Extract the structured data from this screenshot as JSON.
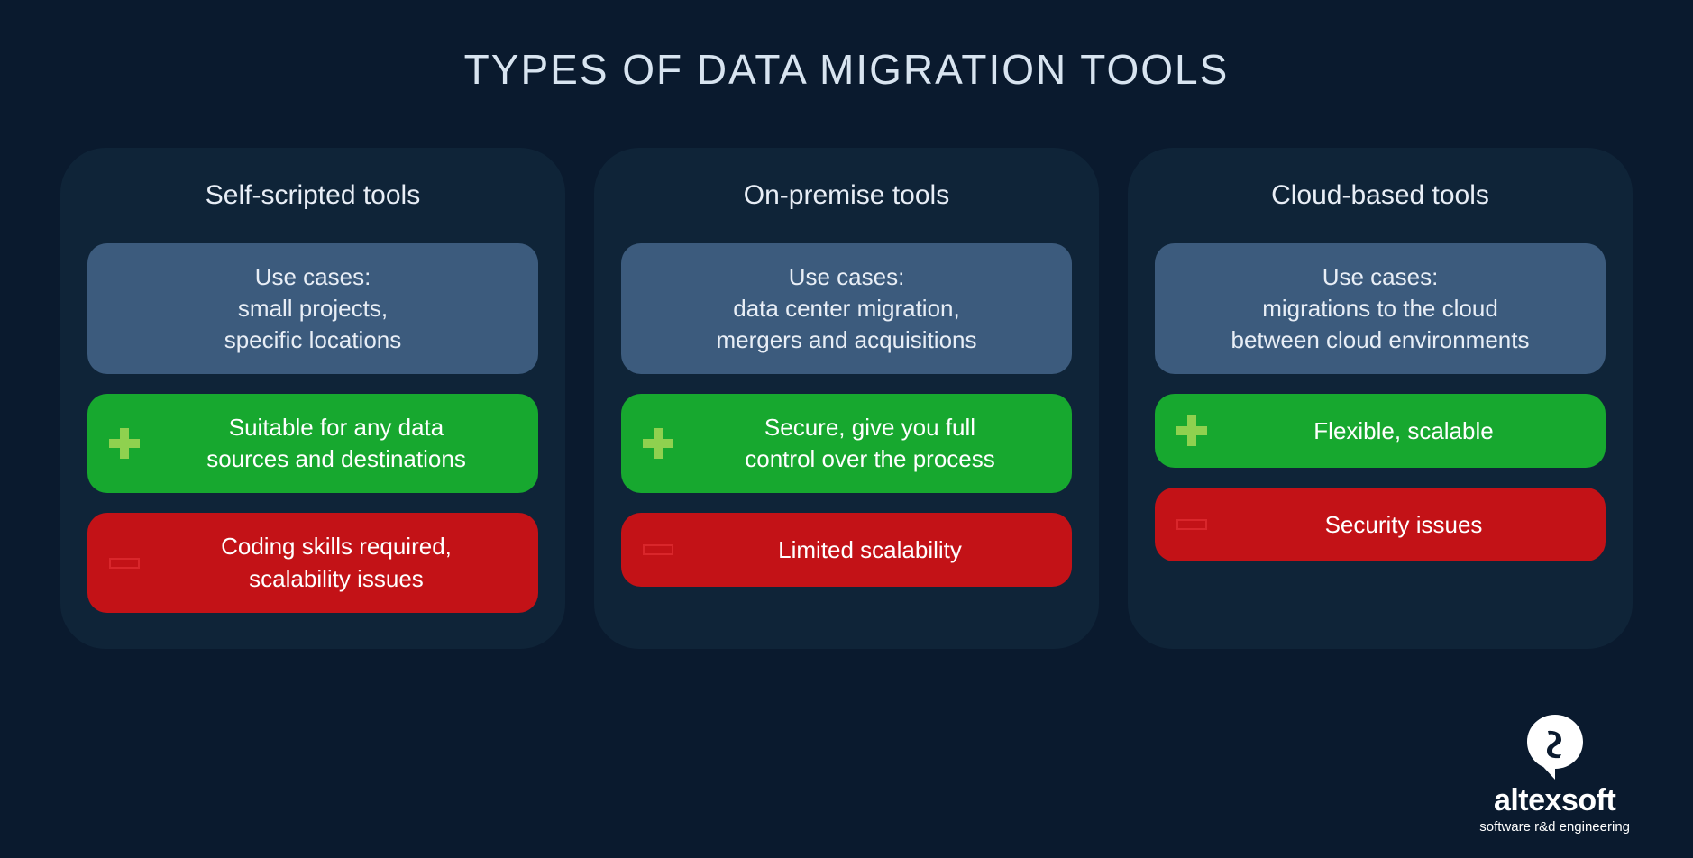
{
  "title": "TYPES OF DATA MIGRATION TOOLS",
  "usecase_label": "Use cases:",
  "cards": [
    {
      "title": "Self-scripted tools",
      "usecases": "small projects,\nspecific locations",
      "pro": "Suitable for any data\nsources and destinations",
      "con": "Coding skills required,\nscalability issues"
    },
    {
      "title": "On-premise tools",
      "usecases": "data center migration,\nmergers and acquisitions",
      "pro": "Secure, give you full\ncontrol over the process",
      "con": "Limited scalability"
    },
    {
      "title": "Cloud-based tools",
      "usecases": "migrations to the cloud\nbetween cloud environments",
      "pro": "Flexible, scalable",
      "con": "Security issues"
    }
  ],
  "brand": {
    "name": "altexsoft",
    "tagline": "software r&d engineering"
  }
}
